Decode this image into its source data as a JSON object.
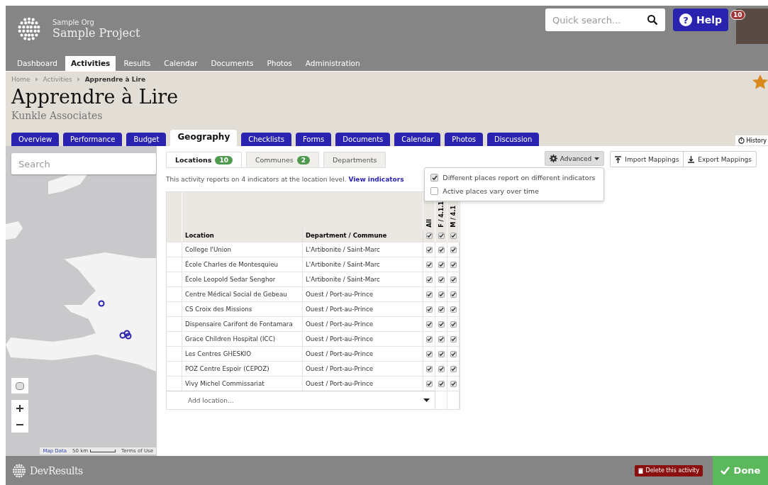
{
  "header": {
    "org": "Sample Org",
    "project": "Sample Project",
    "search": {
      "placeholder": "Quick search..."
    },
    "help": "Help",
    "help_icon": "?",
    "notifications": "10"
  },
  "nav": [
    {
      "label": "Dashboard",
      "selected": false
    },
    {
      "label": "Activities",
      "selected": true
    },
    {
      "label": "Results",
      "selected": false
    },
    {
      "label": "Calendar",
      "selected": false
    },
    {
      "label": "Documents",
      "selected": false
    },
    {
      "label": "Photos",
      "selected": false
    },
    {
      "label": "Administration",
      "selected": false
    }
  ],
  "breadcrumbs": [
    "Home",
    "Activities",
    "Apprendre à Lire"
  ],
  "starred": true,
  "title": "Apprendre à Lire",
  "subtitle": "Kunkle Associates",
  "tabs": [
    {
      "label": "Overview",
      "selected": false
    },
    {
      "label": "Performance",
      "selected": false
    },
    {
      "label": "Budget",
      "selected": false
    },
    {
      "label": "Geography",
      "selected": true
    },
    {
      "label": "Checklists",
      "selected": false
    },
    {
      "label": "Forms",
      "selected": false
    },
    {
      "label": "Documents",
      "selected": false
    },
    {
      "label": "Calendar",
      "selected": false
    },
    {
      "label": "Photos",
      "selected": false
    },
    {
      "label": "Discussion",
      "selected": false
    }
  ],
  "history": "History",
  "map": {
    "search": {
      "placeholder": "Search"
    },
    "map_data": "Map Data",
    "scale": "50 km",
    "terms": "Terms of Use"
  },
  "subtabs": [
    {
      "label": "Locations",
      "count": "10",
      "selected": true
    },
    {
      "label": "Communes",
      "count": "2",
      "selected": false
    },
    {
      "label": "Departments",
      "selected": false
    }
  ],
  "advanced": {
    "label": "Advanced",
    "expanded": true,
    "options": [
      {
        "label": "Different places report on different indicators",
        "checked": true
      },
      {
        "label": "Active places vary over time",
        "checked": false
      }
    ]
  },
  "actions": [
    "Import Mappings",
    "Export Mappings"
  ],
  "info": {
    "text": "This activity reports on 4 indicators at the location level.",
    "link": "View indicators"
  },
  "table": {
    "columns": [
      "Location",
      "Department / Commune"
    ],
    "indicators": [
      {
        "label": "All",
        "checked": true
      },
      {
        "label": "F / 4.1.1",
        "checked": true
      },
      {
        "label": "M / 4.1",
        "checked": true
      }
    ],
    "rows": [
      {
        "location": "College l'Union",
        "commune": "L'Artibonite / Saint-Marc",
        "checks": [
          true,
          true,
          true
        ]
      },
      {
        "location": "École Charles de Montesquieu",
        "commune": "L'Artibonite / Saint-Marc",
        "checks": [
          true,
          true,
          true
        ]
      },
      {
        "location": "École Leopold Sedar Senghor",
        "commune": "L'Artibonite / Saint-Marc",
        "checks": [
          true,
          true,
          true
        ]
      },
      {
        "location": "Centre Médical Social de Gebeau",
        "commune": "Ouest / Port-au-Prince",
        "checks": [
          true,
          true,
          true
        ]
      },
      {
        "location": "CS Croix des Missions",
        "commune": "Ouest / Port-au-Prince",
        "checks": [
          true,
          true,
          true
        ]
      },
      {
        "location": "Dispensaire Carifont de Fontamara",
        "commune": "Ouest / Port-au-Prince",
        "checks": [
          true,
          true,
          true
        ]
      },
      {
        "location": "Grace Children Hospital (ICC)",
        "commune": "Ouest / Port-au-Prince",
        "checks": [
          true,
          true,
          true
        ]
      },
      {
        "location": "Les Centres GHESKIO",
        "commune": "Ouest / Port-au-Prince",
        "checks": [
          true,
          true,
          true
        ]
      },
      {
        "location": "POZ Centre Espoir (CEPOZ)",
        "commune": "Ouest / Port-au-Prince",
        "checks": [
          true,
          true,
          true
        ]
      },
      {
        "location": "Vivy Michel Commissariat",
        "commune": "Ouest / Port-au-Prince",
        "checks": [
          true,
          true,
          true
        ]
      }
    ],
    "add": {
      "placeholder": "Add location..."
    }
  },
  "footer": {
    "brand": "DevResults",
    "delete": "Delete this activity",
    "done": "Done"
  }
}
